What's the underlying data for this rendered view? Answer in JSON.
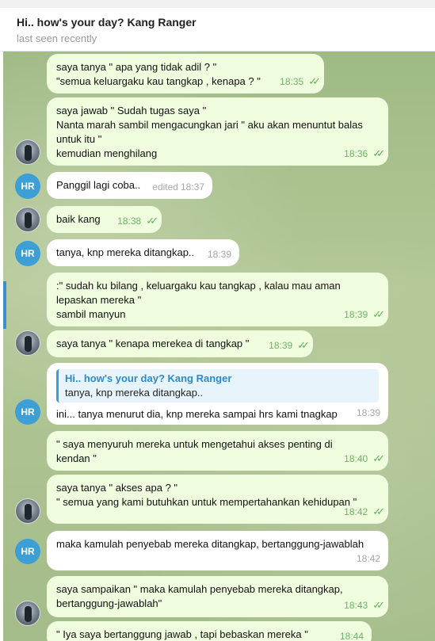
{
  "header": {
    "title": "Hi.. how's your day? Kang Ranger",
    "status": "last seen recently"
  },
  "avatars": {
    "hr_initials": "HR"
  },
  "messages": [
    {
      "lines": [
        "saya tanya \" apa yang tidak adil ? \"",
        "\"semua keluargaku kau tangkap , kenapa ? \""
      ],
      "time": "18:35"
    },
    {
      "lines": [
        "saya jawab \" Sudah tugas saya \"",
        "Nanta marah sambil mengacungkan jari \" aku akan menuntut balas",
        "untuk itu \"",
        "kemudian menghilang"
      ],
      "time": "18:36"
    },
    {
      "lines": [
        "Panggil lagi coba.."
      ],
      "edited": "edited",
      "time": "18:37"
    },
    {
      "lines": [
        "baik kang"
      ],
      "time": "18:38"
    },
    {
      "lines": [
        "tanya, knp mereka ditangkap.."
      ],
      "time": "18:39"
    },
    {
      "lines": [
        ":\" sudah ku bilang , keluargaku kau tangkap , kalau mau aman",
        "lepaskan mereka \"",
        "sambil manyun"
      ],
      "time": "18:39"
    },
    {
      "lines": [
        "saya tanya \" kenapa merekea di tangkap \""
      ],
      "time": "18:39"
    },
    {
      "reply_name": "Hi.. how's your day? Kang Ranger",
      "reply_text": "tanya, knp mereka ditangkap..",
      "lines": [
        "ini... tanya menurut dia, knp mereka sampai hrs kami tnagkap"
      ],
      "time": "18:39"
    },
    {
      "lines": [
        "\" saya menyuruh mereka untuk mengetahui akses penting di",
        "kendan \""
      ],
      "time": "18:40"
    },
    {
      "lines": [
        "saya tanya \" akses apa ? \"",
        "\" semua yang kami butuhkan untuk mempertahankan kehidupan \""
      ],
      "time": "18:42"
    },
    {
      "lines": [
        "maka kamulah penyebab mereka ditangkap, bertanggung-jawablah"
      ],
      "time": "18:42"
    },
    {
      "lines": [
        "saya sampaikan \" maka kamulah penyebab mereka ditangkap,",
        "bertanggung-jawablah\""
      ],
      "time": "18:43"
    },
    {
      "lines": [
        "\" Iya saya bertanggung jawab , tapi bebaskan mereka \""
      ],
      "time": "18:44"
    }
  ],
  "icons": {
    "read_checks": "double-check-icon"
  },
  "colors": {
    "outgoing": "#effdde",
    "incoming": "#ffffff",
    "hr_avatar": "#3d9fd6",
    "check": "#5fb05c"
  }
}
